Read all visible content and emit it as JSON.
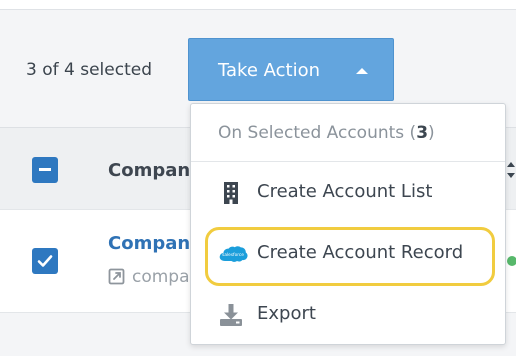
{
  "selection": {
    "count_text": "3 of 4 selected",
    "take_action_label": "Take Action"
  },
  "table": {
    "column_header": "Compan",
    "row": {
      "company_link": "Compan",
      "company_sub": "compa"
    }
  },
  "dropdown": {
    "header_prefix": "On Selected Accounts (",
    "header_count": "3",
    "header_suffix": ")",
    "items": [
      {
        "label": "Create Account List",
        "icon": "building-icon"
      },
      {
        "label": "Create Account Record",
        "icon": "salesforce-cloud-icon"
      },
      {
        "label": "Export",
        "icon": "download-icon"
      }
    ]
  },
  "colors": {
    "button": "#63a5de",
    "checkbox": "#2e78c0",
    "link": "#2f72b5",
    "highlight": "#f1cc3f",
    "status_dot": "#57b86b",
    "salesforce": "#1b9edb"
  }
}
